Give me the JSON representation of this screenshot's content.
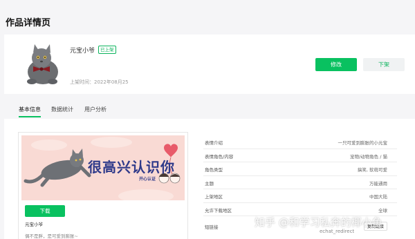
{
  "page": {
    "title": "作品详情页"
  },
  "work": {
    "name": "元宝小爷",
    "status_badge": "已上架",
    "listed_time": "上架时间：2022年08月25",
    "edit_label": "修改",
    "unlist_label": "下架"
  },
  "tabs": [
    {
      "label": "基本信息",
      "active": true
    },
    {
      "label": "数据统计",
      "active": false
    },
    {
      "label": "用户分析",
      "active": false
    }
  ],
  "preview": {
    "banner_text": "很高兴认识你",
    "banner_stamp": "开心认证",
    "download_label": "下载",
    "name": "元宝小爷",
    "description": "偶不是胖，是可爱到膨胀~"
  },
  "info": [
    {
      "label": "表情介绍",
      "value": "一只可爱到膨胀的小元宝"
    },
    {
      "label": "表情角色/内容",
      "value": "宠物/动物角色 / 猫"
    },
    {
      "label": "角色类型",
      "value": "搞笑, 软萌可爱"
    },
    {
      "label": "主题",
      "value": "万能通用"
    },
    {
      "label": "上架地区",
      "value": "中国大陆"
    },
    {
      "label": "允许下载地区",
      "value": "全球"
    },
    {
      "label": "短链接",
      "value": ""
    }
  ],
  "short_link_button": "复制链接",
  "watermark": {
    "text": "知乎 @和学习私奔的椰小鱼",
    "sub": "echat_redirect"
  },
  "colors": {
    "accent": "#09c160",
    "background": "#f5f5f7"
  }
}
